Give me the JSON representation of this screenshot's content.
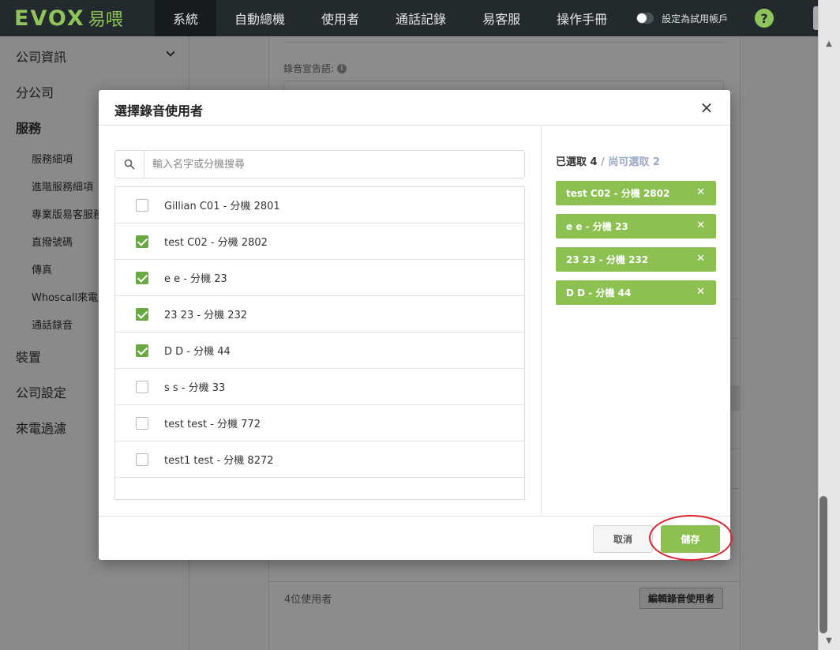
{
  "brand": {
    "logo_text": "EVOX",
    "logo_cn": "易喂"
  },
  "nav": {
    "items": [
      {
        "label": "系統",
        "active": true
      },
      {
        "label": "自動總機",
        "active": false
      },
      {
        "label": "使用者",
        "active": false
      },
      {
        "label": "通話記錄",
        "active": false
      },
      {
        "label": "易客服",
        "active": false
      },
      {
        "label": "操作手冊",
        "active": false
      }
    ],
    "trial_toggle_label": "設定為試用帳戶",
    "help_label": "?"
  },
  "sidebar": {
    "items": [
      {
        "label": "公司資訊"
      },
      {
        "label": "分公司"
      },
      {
        "label": "服務"
      },
      {
        "label": "裝置"
      },
      {
        "label": "公司設定"
      },
      {
        "label": "來電過濾"
      }
    ],
    "sub_items": [
      {
        "label": "服務細項"
      },
      {
        "label": "進階服務細項"
      },
      {
        "label": "專業版易客服務"
      },
      {
        "label": "直撥號碼"
      },
      {
        "label": "傳真"
      },
      {
        "label": "Whoscall來電顯示"
      },
      {
        "label": "通話錄音"
      }
    ]
  },
  "background": {
    "announcement_label": "錄音宣告語:",
    "user_count": "4位使用者",
    "edit_button": "編輯錄音使用者"
  },
  "modal": {
    "title": "選擇錄音使用者",
    "search_placeholder": "輸入名字或分機搜尋",
    "users": [
      {
        "label": "Gillian C01 - 分機 2801",
        "checked": false
      },
      {
        "label": "test C02 - 分機 2802",
        "checked": true
      },
      {
        "label": "e e - 分機 23",
        "checked": true
      },
      {
        "label": "23 23 - 分機 232",
        "checked": true
      },
      {
        "label": "D D - 分機 44",
        "checked": true
      },
      {
        "label": "s s - 分機 33",
        "checked": false
      },
      {
        "label": "test test - 分機 772",
        "checked": false
      },
      {
        "label": "test1 test - 分機 8272",
        "checked": false
      }
    ],
    "selected_label": "已選取 4",
    "remaining_label": " / 尚可選取 2",
    "chips": [
      {
        "label": "test C02 - 分機 2802"
      },
      {
        "label": "e e - 分機 23"
      },
      {
        "label": "23 23 - 分機 232"
      },
      {
        "label": "D D - 分機 44"
      }
    ],
    "cancel_label": "取消",
    "save_label": "儲存"
  },
  "colors": {
    "accent_green": "#8cc152",
    "check_green": "#6aa842",
    "nav_bg": "#232a2e",
    "highlight_red": "#d9232e"
  }
}
